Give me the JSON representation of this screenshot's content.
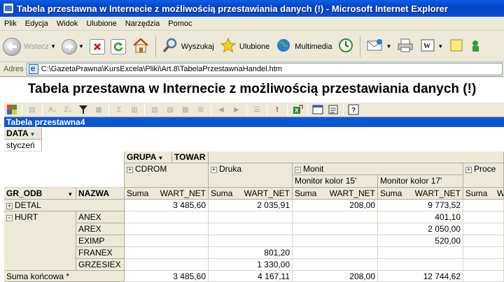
{
  "window": {
    "title": "Tabela przestawna w Internecie z możliwością przestawiania danych (!) - Microsoft Internet Explorer"
  },
  "menu": [
    "Plik",
    "Edycja",
    "Widok",
    "Ulubione",
    "Narzędzia",
    "Pomoc"
  ],
  "toolbar": {
    "back_label": "Wstecz",
    "search_label": "Wyszukaj",
    "favorites_label": "Ulubione",
    "media_label": "Multimedia"
  },
  "address": {
    "label": "Adres",
    "url": "C:\\GazetaPrawna\\KursExcela\\Pliki\\Art.8\\TabelaPrzestawnaHandel.htm"
  },
  "page": {
    "heading": "Tabela przestawna w Internecie z możliwością przestawiania danych (!)"
  },
  "pivot": {
    "name": "Tabela przestawna4",
    "data_field": "DATA",
    "data_value": "styczeń",
    "col_fields": {
      "grupa": "GRUPA",
      "towar": "TOWAR"
    },
    "groups": {
      "cdrom": "CDROM",
      "druka": "Druka",
      "monit": "Monit",
      "proce": "Proce"
    },
    "monitor_items": [
      "Monitor kolor 15'",
      "Monitor kolor 17'"
    ],
    "row_fields": {
      "gr_odb": "GR_ODB",
      "nazwa": "NAZWA"
    },
    "measure": {
      "agg": "Suma",
      "field": "WART_NET"
    },
    "rows": [
      {
        "gr": "DETAL",
        "nazwa": "",
        "cdrom": "3 485,60",
        "druka": "2 035,91",
        "mon15": "208,00",
        "mon17": "9 773,52"
      },
      {
        "gr": "HURT",
        "nazwa": "ANEX",
        "cdrom": "",
        "druka": "",
        "mon15": "",
        "mon17": "401,10"
      },
      {
        "gr": "",
        "nazwa": "AREX",
        "cdrom": "",
        "druka": "",
        "mon15": "",
        "mon17": "2 050,00"
      },
      {
        "gr": "",
        "nazwa": "EXIMP",
        "cdrom": "",
        "druka": "",
        "mon15": "",
        "mon17": "520,00"
      },
      {
        "gr": "",
        "nazwa": "FRANEX",
        "cdrom": "",
        "druka": "801,20",
        "mon15": "",
        "mon17": ""
      },
      {
        "gr": "",
        "nazwa": "GRZESIEX",
        "cdrom": "",
        "druka": "1 330,00",
        "mon15": "",
        "mon17": ""
      }
    ],
    "total": {
      "label": "Suma końcowa *",
      "cdrom": "3 485,60",
      "druka": "4 167,11",
      "mon15": "208,00",
      "mon17": "12 744,62"
    }
  }
}
